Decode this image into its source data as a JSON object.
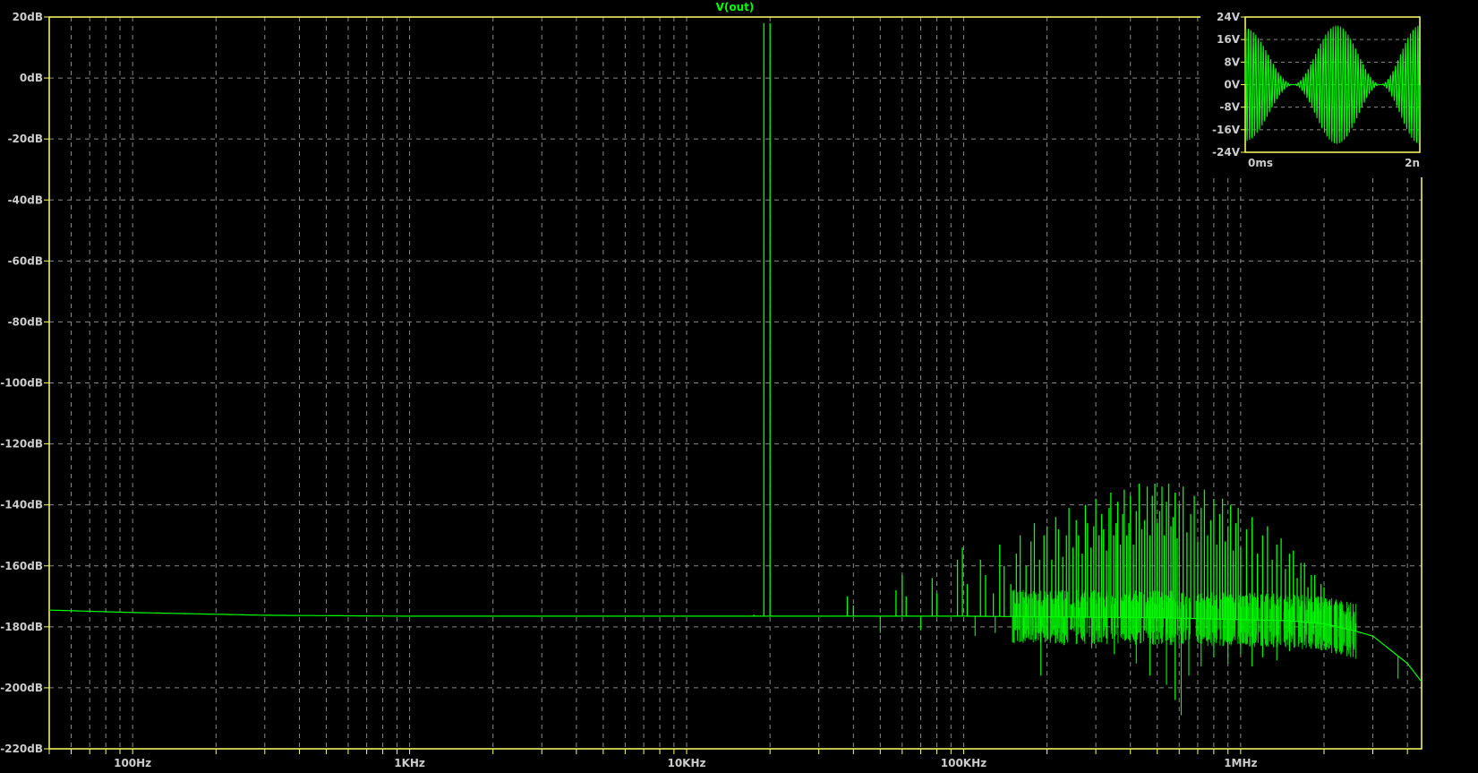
{
  "chart_data": [
    {
      "type": "line",
      "title": "V(out)",
      "x_scale": "log",
      "xlim": [
        50,
        4500000
      ],
      "ylim": [
        -220,
        20
      ],
      "x_ticks": [
        {
          "value": 100,
          "label": "100Hz"
        },
        {
          "value": 1000,
          "label": "1KHz"
        },
        {
          "value": 10000,
          "label": "10KHz"
        },
        {
          "value": 100000,
          "label": "100KHz"
        },
        {
          "value": 1000000,
          "label": "1MHz"
        }
      ],
      "y_ticks": [
        {
          "value": 20,
          "label": "20dB"
        },
        {
          "value": 0,
          "label": "0dB"
        },
        {
          "value": -20,
          "label": "-20dB"
        },
        {
          "value": -40,
          "label": "-40dB"
        },
        {
          "value": -60,
          "label": "-60dB"
        },
        {
          "value": -80,
          "label": "-80dB"
        },
        {
          "value": -100,
          "label": "-100dB"
        },
        {
          "value": -120,
          "label": "-120dB"
        },
        {
          "value": -140,
          "label": "-140dB"
        },
        {
          "value": -160,
          "label": "-160dB"
        },
        {
          "value": -180,
          "label": "-180dB"
        },
        {
          "value": -200,
          "label": "-200dB"
        },
        {
          "value": -220,
          "label": "-220dB"
        }
      ],
      "grid": true,
      "series": [
        {
          "name": "V(out)",
          "color": "#00ff00",
          "baseline": [
            {
              "x": 50,
              "y": -174.5
            },
            {
              "x": 100,
              "y": -175.3
            },
            {
              "x": 300,
              "y": -176.2
            },
            {
              "x": 1000,
              "y": -176.5
            },
            {
              "x": 10000,
              "y": -176.5
            },
            {
              "x": 100000,
              "y": -176.5
            },
            {
              "x": 500000,
              "y": -177
            },
            {
              "x": 1500000,
              "y": -178
            },
            {
              "x": 2000000,
              "y": -179
            },
            {
              "x": 2500000,
              "y": -181
            },
            {
              "x": 3000000,
              "y": -183
            },
            {
              "x": 4000000,
              "y": -192
            },
            {
              "x": 4500000,
              "y": -198
            }
          ],
          "peaks": [
            {
              "x": 17500,
              "y": -176
            },
            {
              "x": 19000,
              "y": 18
            },
            {
              "x": 20000,
              "y": 18
            },
            {
              "x": 38000,
              "y": -170
            },
            {
              "x": 40000,
              "y": -173
            },
            {
              "x": 57000,
              "y": -168
            },
            {
              "x": 60000,
              "y": -163
            },
            {
              "x": 62000,
              "y": -170
            },
            {
              "x": 77000,
              "y": -164
            },
            {
              "x": 80000,
              "y": -169
            },
            {
              "x": 95000,
              "y": -158
            },
            {
              "x": 99000,
              "y": -154
            },
            {
              "x": 103000,
              "y": -166
            },
            {
              "x": 115000,
              "y": -158
            },
            {
              "x": 120000,
              "y": -163
            },
            {
              "x": 128000,
              "y": -169
            },
            {
              "x": 135000,
              "y": -153
            },
            {
              "x": 140000,
              "y": -160
            },
            {
              "x": 148000,
              "y": -166
            },
            {
              "x": 155000,
              "y": -156
            },
            {
              "x": 160000,
              "y": -150
            },
            {
              "x": 168000,
              "y": -160
            },
            {
              "x": 175000,
              "y": -152
            },
            {
              "x": 180000,
              "y": -146
            },
            {
              "x": 188000,
              "y": -158
            },
            {
              "x": 195000,
              "y": -150
            },
            {
              "x": 200000,
              "y": -147
            },
            {
              "x": 208000,
              "y": -158
            },
            {
              "x": 215000,
              "y": -144
            },
            {
              "x": 220000,
              "y": -148
            },
            {
              "x": 228000,
              "y": -157
            },
            {
              "x": 235000,
              "y": -150
            },
            {
              "x": 240000,
              "y": -141
            },
            {
              "x": 248000,
              "y": -154
            },
            {
              "x": 255000,
              "y": -145
            },
            {
              "x": 260000,
              "y": -150
            },
            {
              "x": 268000,
              "y": -156
            },
            {
              "x": 275000,
              "y": -140
            },
            {
              "x": 280000,
              "y": -146
            },
            {
              "x": 288000,
              "y": -154
            },
            {
              "x": 295000,
              "y": -147
            },
            {
              "x": 300000,
              "y": -138
            },
            {
              "x": 308000,
              "y": -150
            },
            {
              "x": 315000,
              "y": -143
            },
            {
              "x": 320000,
              "y": -148
            },
            {
              "x": 328000,
              "y": -155
            },
            {
              "x": 335000,
              "y": -141
            },
            {
              "x": 340000,
              "y": -136
            },
            {
              "x": 348000,
              "y": -150
            },
            {
              "x": 355000,
              "y": -146
            },
            {
              "x": 360000,
              "y": -139
            },
            {
              "x": 368000,
              "y": -153
            },
            {
              "x": 375000,
              "y": -143
            },
            {
              "x": 380000,
              "y": -135
            },
            {
              "x": 388000,
              "y": -150
            },
            {
              "x": 395000,
              "y": -146
            },
            {
              "x": 400000,
              "y": -137
            },
            {
              "x": 410000,
              "y": -153
            },
            {
              "x": 420000,
              "y": -142
            },
            {
              "x": 430000,
              "y": -133
            },
            {
              "x": 440000,
              "y": -148
            },
            {
              "x": 450000,
              "y": -145
            },
            {
              "x": 460000,
              "y": -134
            },
            {
              "x": 470000,
              "y": -150
            },
            {
              "x": 480000,
              "y": -137
            },
            {
              "x": 490000,
              "y": -133
            },
            {
              "x": 500000,
              "y": -146
            },
            {
              "x": 510000,
              "y": -142
            },
            {
              "x": 520000,
              "y": -134
            },
            {
              "x": 530000,
              "y": -150
            },
            {
              "x": 540000,
              "y": -139
            },
            {
              "x": 550000,
              "y": -133
            },
            {
              "x": 560000,
              "y": -147
            },
            {
              "x": 570000,
              "y": -144
            },
            {
              "x": 580000,
              "y": -136
            },
            {
              "x": 590000,
              "y": -151
            },
            {
              "x": 600000,
              "y": -140
            },
            {
              "x": 620000,
              "y": -134
            },
            {
              "x": 640000,
              "y": -149
            },
            {
              "x": 660000,
              "y": -143
            },
            {
              "x": 680000,
              "y": -137
            },
            {
              "x": 700000,
              "y": -152
            },
            {
              "x": 720000,
              "y": -141
            },
            {
              "x": 740000,
              "y": -135
            },
            {
              "x": 760000,
              "y": -150
            },
            {
              "x": 780000,
              "y": -145
            },
            {
              "x": 800000,
              "y": -138
            },
            {
              "x": 820000,
              "y": -153
            },
            {
              "x": 840000,
              "y": -143
            },
            {
              "x": 860000,
              "y": -138
            },
            {
              "x": 880000,
              "y": -152
            },
            {
              "x": 900000,
              "y": -147
            },
            {
              "x": 920000,
              "y": -140
            },
            {
              "x": 940000,
              "y": -155
            },
            {
              "x": 960000,
              "y": -146
            },
            {
              "x": 980000,
              "y": -141
            },
            {
              "x": 1000000,
              "y": -154
            },
            {
              "x": 1050000,
              "y": -148
            },
            {
              "x": 1100000,
              "y": -144
            },
            {
              "x": 1150000,
              "y": -156
            },
            {
              "x": 1200000,
              "y": -150
            },
            {
              "x": 1250000,
              "y": -147
            },
            {
              "x": 1300000,
              "y": -158
            },
            {
              "x": 1350000,
              "y": -153
            },
            {
              "x": 1400000,
              "y": -151
            },
            {
              "x": 1450000,
              "y": -161
            },
            {
              "x": 1500000,
              "y": -156
            },
            {
              "x": 1550000,
              "y": -155
            },
            {
              "x": 1600000,
              "y": -164
            },
            {
              "x": 1650000,
              "y": -159
            },
            {
              "x": 1700000,
              "y": -159
            },
            {
              "x": 1750000,
              "y": -167
            },
            {
              "x": 1800000,
              "y": -163
            },
            {
              "x": 1850000,
              "y": -163
            },
            {
              "x": 1900000,
              "y": -170
            },
            {
              "x": 1950000,
              "y": -166
            },
            {
              "x": 2000000,
              "y": -167
            },
            {
              "x": 2100000,
              "y": -171
            },
            {
              "x": 2200000,
              "y": -172
            },
            {
              "x": 2300000,
              "y": -174
            },
            {
              "x": 2400000,
              "y": -176
            },
            {
              "x": 2500000,
              "y": -178
            },
            {
              "x": 2600000,
              "y": -179
            }
          ],
          "dips": [
            {
              "x": 50000,
              "y": -182
            },
            {
              "x": 70000,
              "y": -181
            },
            {
              "x": 110000,
              "y": -183
            },
            {
              "x": 130000,
              "y": -182
            },
            {
              "x": 165000,
              "y": -184
            },
            {
              "x": 190000,
              "y": -196
            },
            {
              "x": 230000,
              "y": -186
            },
            {
              "x": 290000,
              "y": -187
            },
            {
              "x": 350000,
              "y": -189
            },
            {
              "x": 420000,
              "y": -192
            },
            {
              "x": 470000,
              "y": -196
            },
            {
              "x": 540000,
              "y": -199
            },
            {
              "x": 580000,
              "y": -204
            },
            {
              "x": 610000,
              "y": -209
            },
            {
              "x": 650000,
              "y": -196
            },
            {
              "x": 720000,
              "y": -193
            },
            {
              "x": 800000,
              "y": -190
            },
            {
              "x": 900000,
              "y": -192
            },
            {
              "x": 1000000,
              "y": -189
            },
            {
              "x": 1100000,
              "y": -193
            },
            {
              "x": 1200000,
              "y": -190
            },
            {
              "x": 1350000,
              "y": -191
            },
            {
              "x": 1500000,
              "y": -188
            },
            {
              "x": 1700000,
              "y": -186
            },
            {
              "x": 2000000,
              "y": -184
            },
            {
              "x": 3700000,
              "y": -197
            }
          ]
        }
      ]
    },
    {
      "type": "line",
      "xlim": [
        0,
        2
      ],
      "ylim": [
        -24,
        24
      ],
      "x_ticks": [
        {
          "value": 0,
          "label": "0ms"
        },
        {
          "value": 2,
          "label": "2n"
        }
      ],
      "y_ticks": [
        {
          "value": 24,
          "label": "24V"
        },
        {
          "value": 16,
          "label": "16V"
        },
        {
          "value": 8,
          "label": "8V"
        },
        {
          "value": 0,
          "label": "0V"
        },
        {
          "value": -8,
          "label": "-8V"
        },
        {
          "value": -16,
          "label": "-16V"
        },
        {
          "value": -24,
          "label": "-24V"
        }
      ],
      "grid": true,
      "series": [
        {
          "color": "#00ff00",
          "envelope_peaks": [
            {
              "x": 0,
              "y": 20
            },
            {
              "x": 0.55,
              "y": 0
            },
            {
              "x": 1.05,
              "y": 21
            },
            {
              "x": 1.55,
              "y": 0
            },
            {
              "x": 2,
              "y": 21
            }
          ]
        }
      ]
    }
  ]
}
